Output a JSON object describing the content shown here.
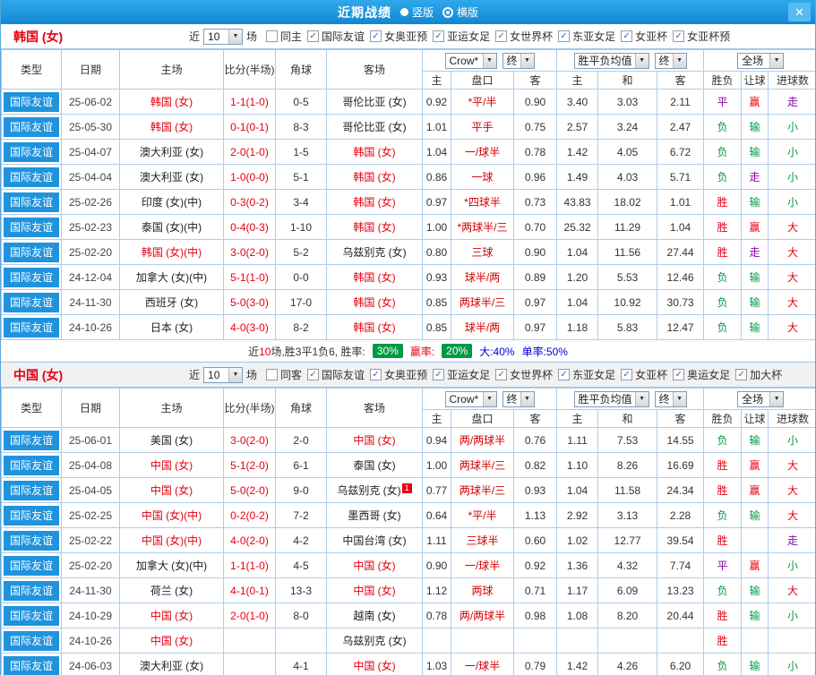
{
  "titlebar": {
    "title": "近期战绩",
    "radios": [
      {
        "label": "竖版",
        "selected": false
      },
      {
        "label": "横版",
        "selected": true
      }
    ],
    "close_label": "✕"
  },
  "colors": {
    "accent_blue": "#2093dd",
    "red": "#e60012",
    "green": "#009944",
    "purple": "#8b00b0",
    "grid_line": "#aecdea"
  },
  "result_colors": {
    "胜": "#e60012",
    "负": "#009944",
    "平": "#8b00b0",
    "赢": "#e60012",
    "输": "#009944",
    "走": "#8b00b0",
    "大": "#e60012",
    "小": "#009944"
  },
  "sections": [
    {
      "team_title": "韩国 (女)",
      "recent_label": "近",
      "recent_count": "10",
      "games_label": "场",
      "filters": [
        {
          "label": "同主",
          "checked": false
        },
        {
          "label": "国际友谊",
          "checked": true
        },
        {
          "label": "女奥亚预",
          "checked": true
        },
        {
          "label": "亚运女足",
          "checked": true
        },
        {
          "label": "女世界杯",
          "checked": true
        },
        {
          "label": "东亚女足",
          "checked": true
        },
        {
          "label": "女亚杯",
          "checked": true
        },
        {
          "label": "女亚杯预",
          "checked": true
        }
      ],
      "header": {
        "type": "类型",
        "date": "日期",
        "home": "主场",
        "score": "比分(半场)",
        "corner": "角球",
        "away": "客场",
        "bookmaker": "Crow*",
        "final": "终",
        "avg": "胜平负均值",
        "scope": "全场",
        "sub": [
          "主",
          "盘口",
          "客",
          "主",
          "和",
          "客",
          "胜负",
          "让球",
          "进球数"
        ]
      },
      "rows": [
        {
          "type": "国际友谊",
          "date": "25-06-02",
          "home": "韩国 (女)",
          "hf": true,
          "score": "1-1(1-0)",
          "corner": "0-5",
          "away": "哥伦比亚 (女)",
          "af": false,
          "odds": [
            "0.92",
            "*平/半",
            "0.90"
          ],
          "avg": [
            "3.40",
            "3.03",
            "2.11"
          ],
          "res": [
            "平",
            "赢",
            "走"
          ]
        },
        {
          "type": "国际友谊",
          "date": "25-05-30",
          "home": "韩国 (女)",
          "hf": true,
          "score": "0-1(0-1)",
          "corner": "8-3",
          "away": "哥伦比亚 (女)",
          "af": false,
          "odds": [
            "1.01",
            "平手",
            "0.75"
          ],
          "avg": [
            "2.57",
            "3.24",
            "2.47"
          ],
          "res": [
            "负",
            "输",
            "小"
          ]
        },
        {
          "type": "国际友谊",
          "date": "25-04-07",
          "home": "澳大利亚 (女)",
          "hf": false,
          "score": "2-0(1-0)",
          "corner": "1-5",
          "away": "韩国 (女)",
          "af": true,
          "odds": [
            "1.04",
            "一/球半",
            "0.78"
          ],
          "avg": [
            "1.42",
            "4.05",
            "6.72"
          ],
          "res": [
            "负",
            "输",
            "小"
          ]
        },
        {
          "type": "国际友谊",
          "date": "25-04-04",
          "home": "澳大利亚 (女)",
          "hf": false,
          "score": "1-0(0-0)",
          "corner": "5-1",
          "away": "韩国 (女)",
          "af": true,
          "odds": [
            "0.86",
            "一球",
            "0.96"
          ],
          "avg": [
            "1.49",
            "4.03",
            "5.71"
          ],
          "res": [
            "负",
            "走",
            "小"
          ]
        },
        {
          "type": "国际友谊",
          "date": "25-02-26",
          "home": "印度 (女)(中)",
          "hf": false,
          "score": "0-3(0-2)",
          "corner": "3-4",
          "away": "韩国 (女)",
          "af": true,
          "odds": [
            "0.97",
            "*四球半",
            "0.73"
          ],
          "avg": [
            "43.83",
            "18.02",
            "1.01"
          ],
          "res": [
            "胜",
            "输",
            "小"
          ]
        },
        {
          "type": "国际友谊",
          "date": "25-02-23",
          "home": "泰国 (女)(中)",
          "hf": false,
          "score": "0-4(0-3)",
          "corner": "1-10",
          "away": "韩国 (女)",
          "af": true,
          "odds": [
            "1.00",
            "*两球半/三",
            "0.70"
          ],
          "avg": [
            "25.32",
            "11.29",
            "1.04"
          ],
          "res": [
            "胜",
            "赢",
            "大"
          ]
        },
        {
          "type": "国际友谊",
          "date": "25-02-20",
          "home": "韩国 (女)(中)",
          "hf": true,
          "score": "3-0(2-0)",
          "corner": "5-2",
          "away": "乌兹别克 (女)",
          "af": false,
          "odds": [
            "0.80",
            "三球",
            "0.90"
          ],
          "avg": [
            "1.04",
            "11.56",
            "27.44"
          ],
          "res": [
            "胜",
            "走",
            "大"
          ]
        },
        {
          "type": "国际友谊",
          "date": "24-12-04",
          "home": "加拿大 (女)(中)",
          "hf": false,
          "score": "5-1(1-0)",
          "corner": "0-0",
          "away": "韩国 (女)",
          "af": true,
          "odds": [
            "0.93",
            "球半/两",
            "0.89"
          ],
          "avg": [
            "1.20",
            "5.53",
            "12.46"
          ],
          "res": [
            "负",
            "输",
            "大"
          ]
        },
        {
          "type": "国际友谊",
          "date": "24-11-30",
          "home": "西班牙 (女)",
          "hf": false,
          "score": "5-0(3-0)",
          "corner": "17-0",
          "away": "韩国 (女)",
          "af": true,
          "odds": [
            "0.85",
            "两球半/三",
            "0.97"
          ],
          "avg": [
            "1.04",
            "10.92",
            "30.73"
          ],
          "res": [
            "负",
            "输",
            "大"
          ]
        },
        {
          "type": "国际友谊",
          "date": "24-10-26",
          "home": "日本 (女)",
          "hf": false,
          "score": "4-0(3-0)",
          "corner": "8-2",
          "away": "韩国 (女)",
          "af": true,
          "odds": [
            "0.85",
            "球半/两",
            "0.97"
          ],
          "avg": [
            "1.18",
            "5.83",
            "12.47"
          ],
          "res": [
            "负",
            "输",
            "大"
          ]
        }
      ],
      "summary": {
        "t1": "近",
        "t2": "10",
        "t3": "场,胜3平1负6, 胜率:",
        "win_badge": "30%",
        "t4": "赢率:",
        "handicap_badge": "20%",
        "t5": "大:40%",
        "t6": "单率:50%"
      }
    },
    {
      "team_title": "中国 (女)",
      "recent_label": "近",
      "recent_count": "10",
      "games_label": "场",
      "filters": [
        {
          "label": "同客",
          "checked": false
        },
        {
          "label": "国际友谊",
          "checked": true
        },
        {
          "label": "女奥亚预",
          "checked": true
        },
        {
          "label": "亚运女足",
          "checked": true
        },
        {
          "label": "女世界杯",
          "checked": true
        },
        {
          "label": "东亚女足",
          "checked": true
        },
        {
          "label": "女亚杯",
          "checked": true
        },
        {
          "label": "奥运女足",
          "checked": true
        },
        {
          "label": "加大杯",
          "checked": true
        }
      ],
      "header": {
        "type": "类型",
        "date": "日期",
        "home": "主场",
        "score": "比分(半场)",
        "corner": "角球",
        "away": "客场",
        "bookmaker": "Crow*",
        "final": "终",
        "avg": "胜平负均值",
        "scope": "全场",
        "sub": [
          "主",
          "盘口",
          "客",
          "主",
          "和",
          "客",
          "胜负",
          "让球",
          "进球数"
        ]
      },
      "rows": [
        {
          "type": "国际友谊",
          "date": "25-06-01",
          "home": "美国 (女)",
          "hf": false,
          "score": "3-0(2-0)",
          "corner": "2-0",
          "away": "中国 (女)",
          "af": true,
          "odds": [
            "0.94",
            "两/两球半",
            "0.76"
          ],
          "avg": [
            "1.11",
            "7.53",
            "14.55"
          ],
          "res": [
            "负",
            "输",
            "小"
          ]
        },
        {
          "type": "国际友谊",
          "date": "25-04-08",
          "home": "中国 (女)",
          "hf": true,
          "score": "5-1(2-0)",
          "corner": "6-1",
          "away": "泰国 (女)",
          "af": false,
          "odds": [
            "1.00",
            "两球半/三",
            "0.82"
          ],
          "avg": [
            "1.10",
            "8.26",
            "16.69"
          ],
          "res": [
            "胜",
            "赢",
            "大"
          ]
        },
        {
          "type": "国际友谊",
          "date": "25-04-05",
          "home": "中国 (女)",
          "hf": true,
          "score": "5-0(2-0)",
          "corner": "9-0",
          "away": "乌兹别克 (女)",
          "af": false,
          "away_badge": "1",
          "odds": [
            "0.77",
            "两球半/三",
            "0.93"
          ],
          "avg": [
            "1.04",
            "11.58",
            "24.34"
          ],
          "res": [
            "胜",
            "赢",
            "大"
          ]
        },
        {
          "type": "国际友谊",
          "date": "25-02-25",
          "home": "中国 (女)(中)",
          "hf": true,
          "score": "0-2(0-2)",
          "corner": "7-2",
          "away": "墨西哥 (女)",
          "af": false,
          "odds": [
            "0.64",
            "*平/半",
            "1.13"
          ],
          "avg": [
            "2.92",
            "3.13",
            "2.28"
          ],
          "res": [
            "负",
            "输",
            "大"
          ]
        },
        {
          "type": "国际友谊",
          "date": "25-02-22",
          "home": "中国 (女)(中)",
          "hf": true,
          "score": "4-0(2-0)",
          "corner": "4-2",
          "away": "中国台湾 (女)",
          "af": false,
          "odds": [
            "1.11",
            "三球半",
            "0.60"
          ],
          "avg": [
            "1.02",
            "12.77",
            "39.54"
          ],
          "res": [
            "胜",
            "",
            "走"
          ]
        },
        {
          "type": "国际友谊",
          "date": "25-02-20",
          "home": "加拿大 (女)(中)",
          "hf": false,
          "score": "1-1(1-0)",
          "corner": "4-5",
          "away": "中国 (女)",
          "af": true,
          "odds": [
            "0.90",
            "一/球半",
            "0.92"
          ],
          "avg": [
            "1.36",
            "4.32",
            "7.74"
          ],
          "res": [
            "平",
            "赢",
            "小"
          ]
        },
        {
          "type": "国际友谊",
          "date": "24-11-30",
          "home": "荷兰 (女)",
          "hf": false,
          "score": "4-1(0-1)",
          "corner": "13-3",
          "away": "中国 (女)",
          "af": true,
          "odds": [
            "1.12",
            "两球",
            "0.71"
          ],
          "avg": [
            "1.17",
            "6.09",
            "13.23"
          ],
          "res": [
            "负",
            "输",
            "大"
          ]
        },
        {
          "type": "国际友谊",
          "date": "24-10-29",
          "home": "中国 (女)",
          "hf": true,
          "score": "2-0(1-0)",
          "corner": "8-0",
          "away": "越南 (女)",
          "af": false,
          "odds": [
            "0.78",
            "两/两球半",
            "0.98"
          ],
          "avg": [
            "1.08",
            "8.20",
            "20.44"
          ],
          "res": [
            "胜",
            "输",
            "小"
          ]
        },
        {
          "type": "国际友谊",
          "date": "24-10-26",
          "home": "中国 (女)",
          "hf": true,
          "score": "",
          "corner": "",
          "away": "乌兹别克 (女)",
          "af": false,
          "odds": [
            "",
            "",
            ""
          ],
          "avg": [
            "",
            "",
            ""
          ],
          "res": [
            "胜",
            "",
            ""
          ]
        },
        {
          "type": "国际友谊",
          "date": "24-06-03",
          "home": "澳大利亚 (女)",
          "hf": false,
          "score": "",
          "corner": "4-1",
          "away": "中国 (女)",
          "af": true,
          "odds": [
            "1.03",
            "一/球半",
            "0.79"
          ],
          "avg": [
            "1.42",
            "4.26",
            "6.20"
          ],
          "res": [
            "负",
            "输",
            "小"
          ]
        }
      ]
    }
  ]
}
